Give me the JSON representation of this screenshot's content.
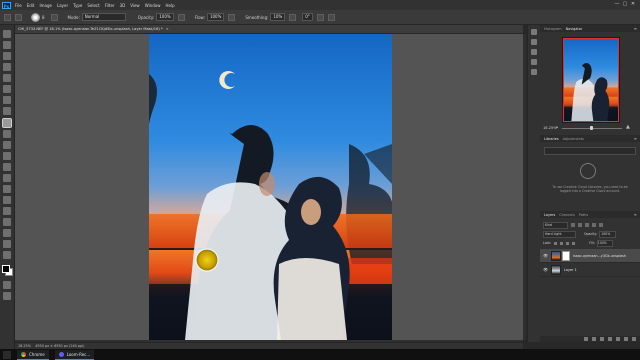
{
  "menubar": {
    "app_logo": "Ps",
    "items": [
      "File",
      "Edit",
      "Image",
      "Layer",
      "Type",
      "Select",
      "Filter",
      "3D",
      "View",
      "Window",
      "Help"
    ],
    "window_controls": [
      "—",
      "▢",
      "✕"
    ]
  },
  "options": {
    "brush_size": "8",
    "mode_label": "Mode:",
    "mode_value": "Normal",
    "opacity_label": "Opacity:",
    "opacity_value": "100%",
    "flow_label": "Flow:",
    "flow_value": "100%",
    "smoothing_label": "Smoothing:",
    "smoothing_value": "10%",
    "angle_value": "0°"
  },
  "document": {
    "tab_title": "CHI_5733.NEF @ 18.1% (Isaac-ayenaan-TeZ1CKjd5lo-unsplash, Layer Mask/16) *",
    "close_glyph": "×",
    "zoom_status": "18.25%",
    "doc_info": "4950 px × 6930 px (240 ppi)"
  },
  "navigator": {
    "tabs": [
      "Histogram",
      "Navigator"
    ],
    "active_tab": "Navigator",
    "zoom": "18.25%"
  },
  "libraries": {
    "tabs": [
      "Libraries",
      "Adjustments"
    ],
    "message": "To use Creative Cloud Libraries, you need to be logged into a Creative Cloud account."
  },
  "layers": {
    "tabs": [
      "Layers",
      "Channels",
      "Paths"
    ],
    "filter_kind": "Kind",
    "blend_mode": "Hard Light",
    "opacity_label": "Opacity:",
    "opacity_value": "100%",
    "lock_label": "Lock:",
    "fill_label": "Fill:",
    "fill_value": "100%",
    "rows": [
      {
        "name": "isaac-ayenaan...y3Gk-unsplash",
        "selected": true,
        "has_mask": true
      },
      {
        "name": "Layer 1",
        "selected": false,
        "has_mask": false
      }
    ]
  },
  "taskbar": {
    "items": [
      "Chrome",
      "Loom-Rec..."
    ],
    "accent": "#3e8ed0"
  },
  "colors": {
    "accent": "#31a8ff",
    "panel_bg": "#323232",
    "pasteboard": "#545454",
    "brush_cursor": "#e6c100"
  }
}
